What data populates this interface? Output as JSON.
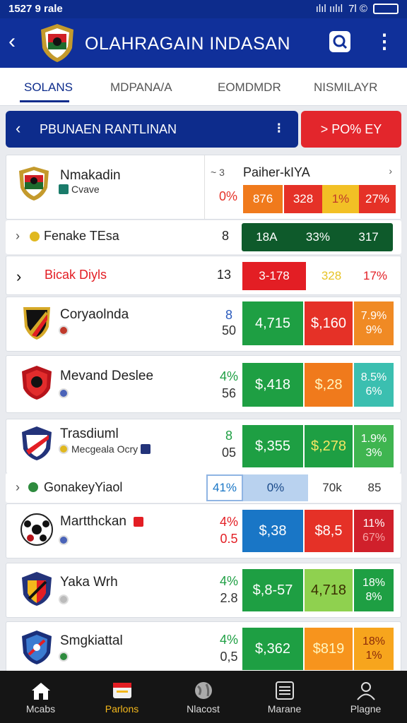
{
  "status": {
    "time": "1527 9 rale",
    "signal": "ılıl ıılıl",
    "battery": "7l ©"
  },
  "app": {
    "title": "OLAHRAGAIN INDASAN"
  },
  "tabs": [
    {
      "label": "SOLANS",
      "active": true
    },
    {
      "label": "MDPANA/A",
      "active": false
    },
    {
      "label": "EOMDMDR",
      "active": false
    },
    {
      "label": "NISMILAYR",
      "active": false
    }
  ],
  "filter": {
    "label": "PBUNAEN RANTLINAN",
    "action": "> PO% EY"
  },
  "highlight": {
    "team": "Nmakadin",
    "sub": "Cvave",
    "panel_title": "Paiher-kIYA",
    "panel_prefix": "~ 3",
    "pct": "0%",
    "cells": [
      "876",
      "328",
      "1%",
      "27%"
    ]
  },
  "row_fenake": {
    "label": "Fenake TEsa",
    "num": "8",
    "cells": [
      "18A",
      "33%",
      "317"
    ]
  },
  "row_bicak": {
    "label": "Bicak Diyls",
    "num": "13",
    "cells": [
      "3-178",
      "328",
      "17%"
    ]
  },
  "row_gona": {
    "label": "GonakeyYiaol",
    "cells": [
      "41%",
      "0%",
      "70k",
      "85"
    ]
  },
  "teams": [
    {
      "name": "Coryaolnda",
      "sub": "",
      "t": "8",
      "b": "50",
      "c1": "4,715",
      "c2": "$,160",
      "c3a": "7.9%",
      "c3b": "9%",
      "colors": [
        "#1e9f43",
        "#e53127",
        "#f08a24"
      ]
    },
    {
      "name": "Mevand Deslee",
      "sub": "",
      "t": "4%",
      "b": "56",
      "c1": "$,418",
      "c2": "$,28",
      "c3a": "8.5%",
      "c3b": "6%",
      "colors": [
        "#1e9f43",
        "#f07a1c",
        "#3bbfb0"
      ]
    },
    {
      "name": "Trasdiuml",
      "sub": "Mecgeala Ocry",
      "t": "8",
      "b": "05",
      "c1": "$,355",
      "c2": "$,278",
      "c3a": "1.9%",
      "c3b": "3%",
      "colors": [
        "#1e9f43",
        "#1e9f43",
        "#3fb550"
      ]
    },
    {
      "name": "Martthckan",
      "sub": "",
      "t": "4%",
      "b": "0.5",
      "c1": "$,38",
      "c2": "$8,5",
      "c3a": "11%",
      "c3b": "67%",
      "colors": [
        "#1976c6",
        "#e53127",
        "#d0202b"
      ]
    },
    {
      "name": "Yaka Wrh",
      "sub": "",
      "t": "4%",
      "b": "2.8",
      "c1": "$,8-57",
      "c2": "4,718",
      "c3a": "18%",
      "c3b": "8%",
      "colors": [
        "#1e9f43",
        "#8fd14f",
        "#1e9f43"
      ]
    },
    {
      "name": "Smgkiattal",
      "sub": "",
      "t": "4%",
      "b": "0,5",
      "c1": "$,362",
      "c2": "$819",
      "c3a": "18%",
      "c3b": "1%",
      "colors": [
        "#1e9f43",
        "#f7941d",
        "#f7a51d"
      ]
    }
  ],
  "nav": [
    {
      "label": "Mcabs",
      "active": false
    },
    {
      "label": "Parlons",
      "active": true
    },
    {
      "label": "Nlacost",
      "active": false
    },
    {
      "label": "Marane",
      "active": false
    },
    {
      "label": "Plagne",
      "active": false
    }
  ]
}
